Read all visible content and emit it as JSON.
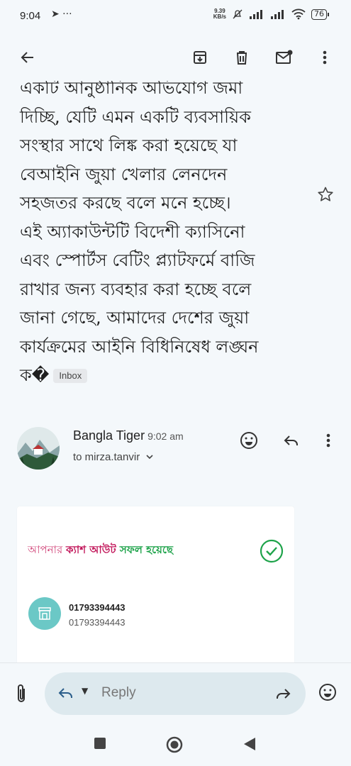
{
  "status": {
    "time": "9:04",
    "net_speed_value": "9.39",
    "net_speed_unit": "KB/s",
    "battery": "76"
  },
  "toolbar": {
    "icons": [
      "back-arrow-icon",
      "archive-icon",
      "delete-icon",
      "mark-unread-icon",
      "more-vert-icon"
    ]
  },
  "email": {
    "snippet_lines": [
      "একটি আনুষ্ঠানিক অভিযোগ জমা",
      "দিচ্ছি, যেটি এমন একটি ব্যবসায়িক",
      "সংস্থার সাথে লিঙ্ক করা হয়েছে যা",
      "বেআইনি জুয়া খেলার লেনদেন",
      "সহজতর করছে বলে মনে হচ্ছে।",
      "এই অ্যাকাউন্টটি বিদেশী ক্যাসিনো",
      "এবং স্পোর্টস বেটিং প্ল্যাটফর্মে বাজি",
      "রাখার জন্য ব্যবহার করা হচ্ছে বলে",
      "জানা গেছে, আমাদের দেশের জুয়া",
      "কার্যক্রমের আইনি বিধিনিষেধ লঙ্ঘন",
      "ক�"
    ],
    "label": "Inbox",
    "sender": "Bangla Tiger",
    "time": "9:02 am",
    "to": "to mirza.tanvir"
  },
  "card": {
    "cash_out_part1": "আপনার ",
    "cash_out_part2": "ক্যাশ আউট ",
    "cash_out_part3": "সফল হয়েছে",
    "account_number": "01793394443",
    "account_number_secondary": "01793394443"
  },
  "reply_bar": {
    "reply_label": "Reply"
  },
  "colors": {
    "background": "#f4f8fb",
    "reply_pill": "#dde9ee",
    "success_green": "#1ea34a",
    "brand_pink": "#c2185b",
    "store_teal": "#6bc8c6"
  }
}
